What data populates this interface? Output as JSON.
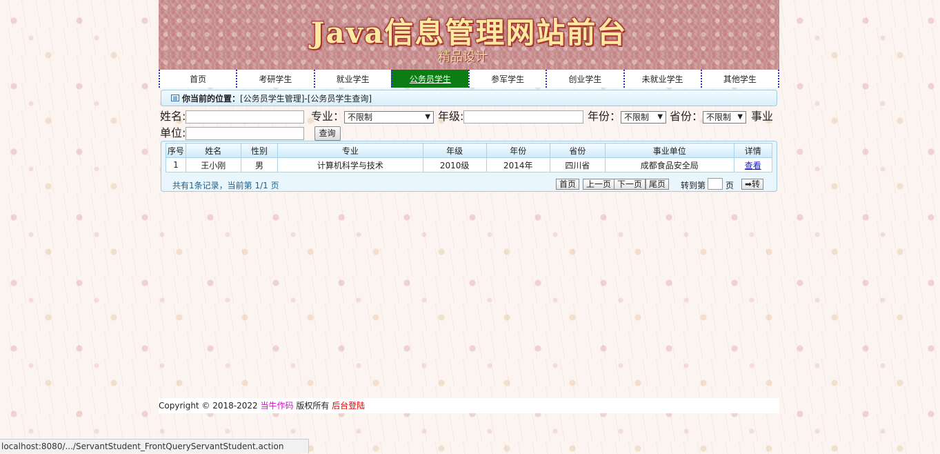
{
  "header": {
    "title": "Java信息管理网站前台",
    "subtitle": "精品设计"
  },
  "nav": {
    "items": [
      {
        "label": "首页"
      },
      {
        "label": "考研学生"
      },
      {
        "label": "就业学生"
      },
      {
        "label": "公务员学生",
        "active": true
      },
      {
        "label": "参军学生"
      },
      {
        "label": "创业学生"
      },
      {
        "label": "未就业学生"
      },
      {
        "label": "其他学生"
      }
    ]
  },
  "location": {
    "label": "你当前的位置：",
    "path": "[公务员学生管理]-[公务员学生查询]"
  },
  "search": {
    "name_label": "姓名:",
    "name_value": "",
    "major_label": "专业：",
    "major_value": "不限制",
    "grade_label": "年级:",
    "grade_value": "",
    "year_label": "年份：",
    "year_value": "不限制",
    "province_label": "省份：",
    "province_value": "不限制",
    "unit_label_1": "事业",
    "unit_label_2": "单位:",
    "unit_value": "",
    "query_button": "查询"
  },
  "table": {
    "headers": [
      "序号",
      "姓名",
      "性别",
      "专业",
      "年级",
      "年份",
      "省份",
      "事业单位",
      "详情"
    ],
    "rows": [
      [
        "1",
        "王小刚",
        "男",
        "计算机科学与技术",
        "2010级",
        "2014年",
        "四川省",
        "成都食品安全局",
        "查看"
      ]
    ]
  },
  "pager": {
    "info": "共有1条记录，当前第 1/1 页",
    "first": "首页",
    "prev": "上一页",
    "next": "下一页",
    "last": "尾页",
    "goto_prefix": "转到第",
    "goto_suffix": "页",
    "goto_button": "➡转"
  },
  "footer": {
    "copyright": "Copyright © 2018-2022 ",
    "author": "当牛作码",
    "rights": " 版权所有 ",
    "admin_link": "后台登陆"
  },
  "statusbar": {
    "url": "localhost:8080/.../ServantStudent_FrontQueryServantStudent.action"
  }
}
